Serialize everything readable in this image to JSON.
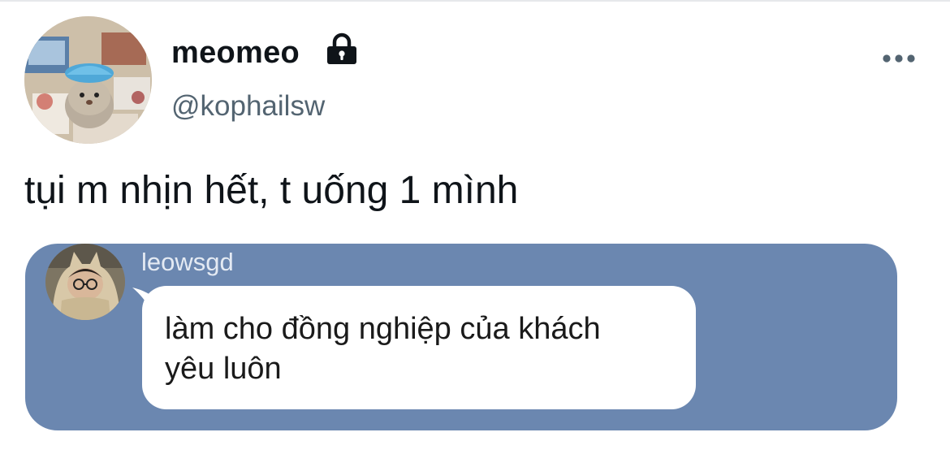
{
  "author": {
    "display_name": "meomeo",
    "handle": "@kophailsw",
    "avatar_icon": "hamster-avatar",
    "protected_icon": "lock-icon"
  },
  "menu": {
    "icon": "more-horizontal-icon"
  },
  "tweet": {
    "text": "tụi m nhịn hết, t uống 1 mình"
  },
  "quote": {
    "background": "#6b87b0",
    "author_name": "leowsgd",
    "avatar_icon": "person-avatar",
    "lines": [
      "làm cho đồng nghiệp của khách",
      "yêu luôn"
    ]
  }
}
